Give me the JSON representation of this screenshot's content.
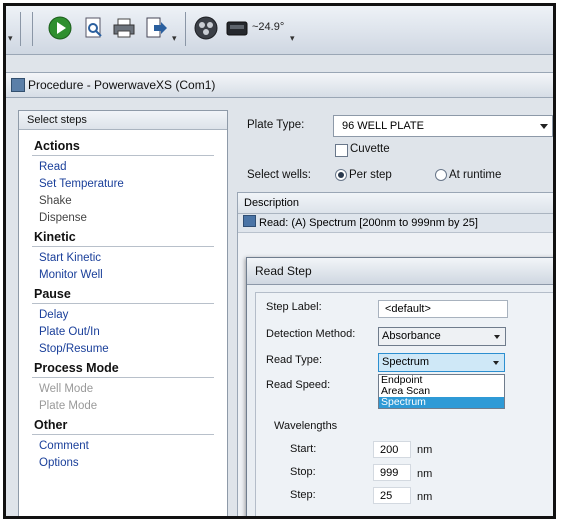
{
  "toolbar": {
    "temperature_text": "~24.9°",
    "icons": [
      "undo-dropdown",
      "play-icon",
      "search-doc-icon",
      "printer-icon",
      "export-icon",
      "reels-icon",
      "reader-icon"
    ]
  },
  "window": {
    "title": "Procedure - PowerwaveXS (Com1)"
  },
  "steps_panel": {
    "header": "Select steps",
    "groups": [
      {
        "title": "Actions",
        "items": [
          "Read",
          "Set Temperature",
          "Shake",
          "Dispense"
        ]
      },
      {
        "title": "Kinetic",
        "items": [
          "Start Kinetic",
          "Monitor Well"
        ]
      },
      {
        "title": "Pause",
        "items": [
          "Delay",
          "Plate Out/In",
          "Stop/Resume"
        ]
      },
      {
        "title": "Process Mode",
        "items": [
          "Well Mode",
          "Plate Mode"
        ]
      },
      {
        "title": "Other",
        "items": [
          "Comment",
          "Options"
        ]
      }
    ]
  },
  "plate": {
    "label": "Plate Type:",
    "value": "96 WELL PLATE",
    "cuvette_label": "Cuvette",
    "select_wells_label": "Select wells:",
    "per_step_label": "Per step",
    "at_runtime_label": "At runtime"
  },
  "description": {
    "header": "Description",
    "row_prefix": "Read:",
    "row_text": "(A) Spectrum [200nm to 999nm by 25]"
  },
  "read_step": {
    "title": "Read Step",
    "step_label_label": "Step Label:",
    "step_label_value": "<default>",
    "detection_method_label": "Detection Method:",
    "detection_method_value": "Absorbance",
    "read_type_label": "Read Type:",
    "read_type_value": "Spectrum",
    "read_type_options": [
      "Endpoint",
      "Area Scan",
      "Spectrum"
    ],
    "read_speed_label": "Read Speed:",
    "wavelengths_label": "Wavelengths",
    "start_label": "Start:",
    "start_value": "200",
    "stop_label": "Stop:",
    "stop_value": "999",
    "step_label": "Step:",
    "step_value": "25",
    "unit": "nm"
  }
}
